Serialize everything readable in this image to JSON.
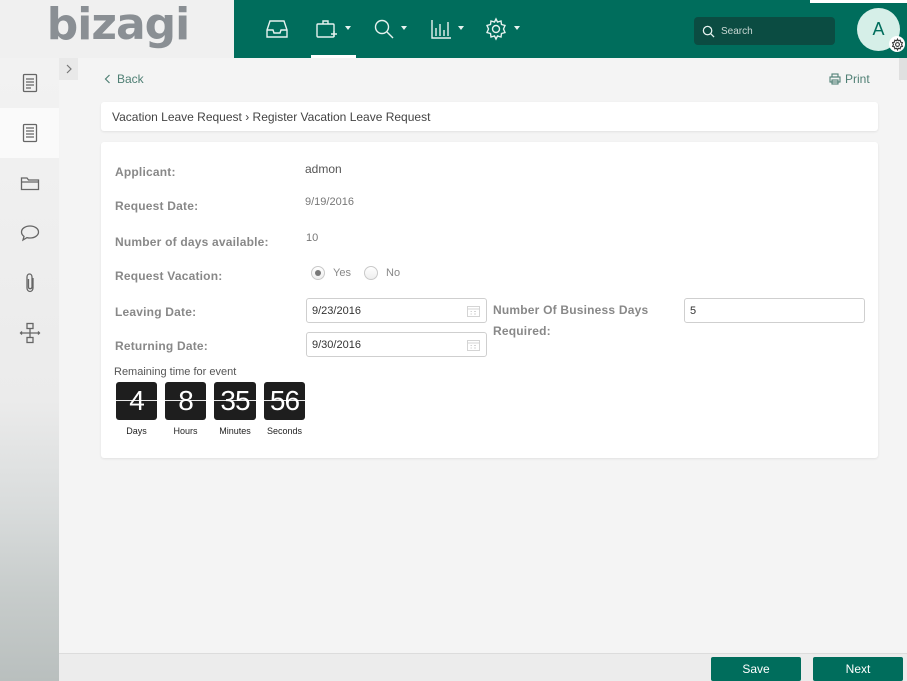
{
  "brand": {
    "name": "bizagi"
  },
  "header": {
    "nav": [
      {
        "id": "inbox",
        "icon": "inbox-icon",
        "caret": false
      },
      {
        "id": "new-case",
        "icon": "new-case-icon",
        "caret": true,
        "active": true
      },
      {
        "id": "search",
        "icon": "search-icon",
        "caret": true
      },
      {
        "id": "analytics",
        "icon": "chart-icon",
        "caret": true
      },
      {
        "id": "admin",
        "icon": "gear-icon",
        "caret": true
      }
    ],
    "search": {
      "placeholder": "Search"
    },
    "user": {
      "initial": "A"
    }
  },
  "sidebar": {
    "items": [
      {
        "id": "summary",
        "icon": "document-list-icon",
        "active": false
      },
      {
        "id": "forms",
        "icon": "form-icon",
        "active": true
      },
      {
        "id": "folders",
        "icon": "folder-icon",
        "active": false
      },
      {
        "id": "comments",
        "icon": "comment-icon",
        "active": false
      },
      {
        "id": "attachments",
        "icon": "paperclip-icon",
        "active": false
      },
      {
        "id": "workflow",
        "icon": "workflow-icon",
        "active": false
      }
    ]
  },
  "actions": {
    "back": "Back",
    "print": "Print"
  },
  "breadcrumb": {
    "text": "Vacation Leave Request › Register Vacation Leave Request"
  },
  "form": {
    "applicant": {
      "label": "Applicant:",
      "value": "admon"
    },
    "request_date": {
      "label": "Request Date:",
      "value": "9/19/2016"
    },
    "days_available": {
      "label": "Number of days available:",
      "value": "10"
    },
    "request_vacation": {
      "label": "Request Vacation:",
      "options": [
        "Yes",
        "No"
      ],
      "selected": "Yes"
    },
    "leaving_date": {
      "label": "Leaving Date:",
      "value": "9/23/2016"
    },
    "returning_date": {
      "label": "Returning Date:",
      "value": "9/30/2016"
    },
    "business_days": {
      "label_line1": "Number Of Business Days",
      "label_line2": "Required:",
      "value": "5"
    }
  },
  "timer": {
    "caption": "Remaining time for event",
    "units": [
      {
        "value": "4",
        "label": "Days"
      },
      {
        "value": "8",
        "label": "Hours"
      },
      {
        "value": "35",
        "label": "Minutes"
      },
      {
        "value": "56",
        "label": "Seconds"
      }
    ]
  },
  "buttons": {
    "save": "Save",
    "next": "Next"
  },
  "colors": {
    "primary": "#006d5c",
    "search_bg": "#0b4c42",
    "avatar_bg": "#d6efe8",
    "timer_bg": "#1e1e1e"
  }
}
